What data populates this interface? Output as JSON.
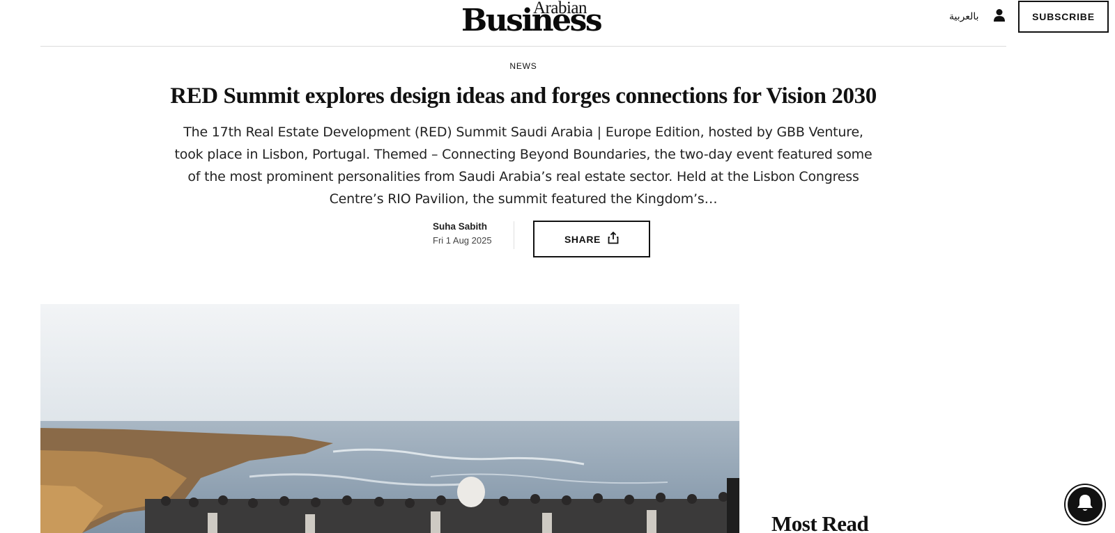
{
  "header": {
    "logo_top": "Arabian",
    "logo_main": "Business",
    "language_link": "بالعربية",
    "account_icon": "user-icon",
    "subscribe_label": "SUBSCRIBE"
  },
  "article": {
    "category": "NEWS",
    "headline": "RED Summit explores design ideas and forges connections for Vision 2030",
    "standfirst": "The 17th Real Estate Development (RED) Summit Saudi Arabia | Europe Edition, hosted by GBB Venture, took place in Lisbon, Portugal. Themed – Connecting Beyond Boundaries, the two-day event featured some of the most prominent personalities from Saudi Arabia’s real estate sector. Held at the Lisbon Congress Centre’s RIO Pavilion, the summit featured the Kingdom’s…",
    "author": "Suha Sabith",
    "date": "Fri 1 Aug 2025",
    "share_label": "SHARE",
    "share_icon": "share-icon"
  },
  "hero_image": {
    "description_icon": "photo"
  },
  "sidebar": {
    "most_read_title": "Most Read"
  },
  "notification": {
    "icon": "bell-icon"
  },
  "colors": {
    "text": "#111111",
    "rule": "#dcdcdc",
    "sea": "#8fa2b3",
    "sky": "#eef1f4",
    "cliff": "#a67a4c"
  }
}
